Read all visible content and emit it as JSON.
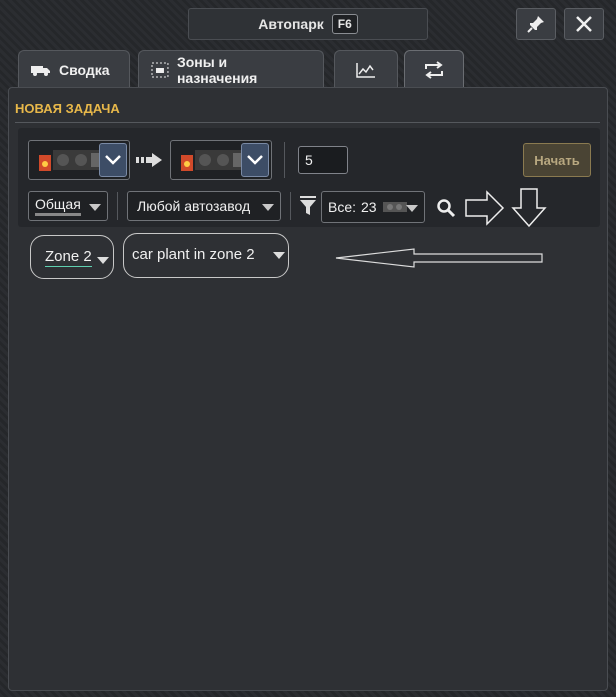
{
  "window": {
    "title": "Автопарк",
    "hotkey": "F6"
  },
  "tabs": [
    {
      "label": "Сводка",
      "icon": "truck-icon"
    },
    {
      "label": "Зоны и назначения",
      "icon": "zones-icon"
    },
    {
      "label": "",
      "icon": "chart-icon"
    },
    {
      "label": "",
      "icon": "swap-arrows-icon",
      "active": true
    }
  ],
  "section_title": "НОВАЯ ЗАДАЧА",
  "task": {
    "quantity": "5",
    "start_label": "Начать",
    "type_select": "Общая",
    "plant_select": "Любой автозавод",
    "filter_prefix": "Все:",
    "filter_count": "23"
  },
  "annotations": {
    "zone_pill": "Zone 2",
    "plant_pill": "car plant in zone 2"
  },
  "colors": {
    "accent": "#e8b84a",
    "chevron_bg": "#3d4d66"
  }
}
